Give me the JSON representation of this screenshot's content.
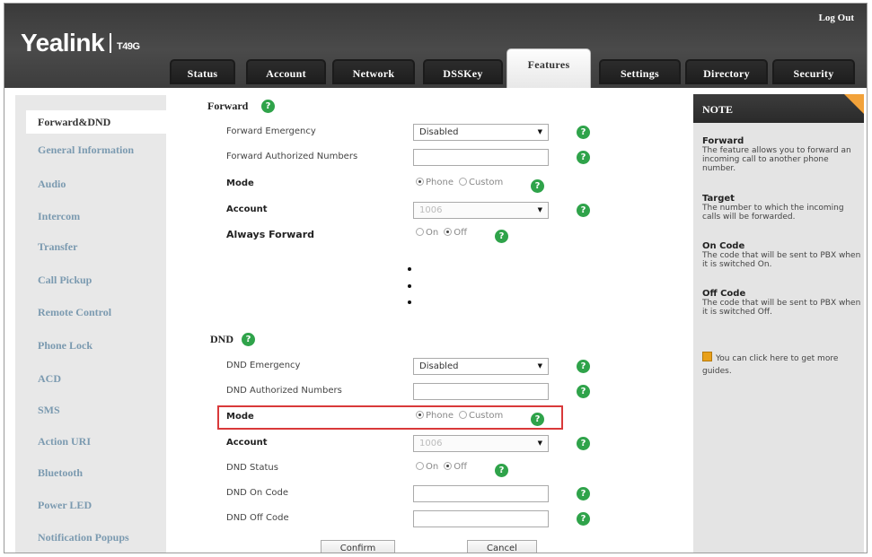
{
  "header": {
    "brand": "Yealink",
    "model": "T49G",
    "logout_label": "Log Out"
  },
  "tabs": [
    {
      "label": "Status"
    },
    {
      "label": "Account"
    },
    {
      "label": "Network"
    },
    {
      "label": "DSSKey"
    },
    {
      "label": "Features",
      "active": true
    },
    {
      "label": "Settings"
    },
    {
      "label": "Directory"
    },
    {
      "label": "Security"
    }
  ],
  "sidebar": {
    "items": [
      {
        "label": "Forward&DND",
        "active": true
      },
      {
        "label": "General Information"
      },
      {
        "label": "Audio"
      },
      {
        "label": "Intercom"
      },
      {
        "label": "Transfer"
      },
      {
        "label": "Call Pickup"
      },
      {
        "label": "Remote Control"
      },
      {
        "label": "Phone Lock"
      },
      {
        "label": "ACD"
      },
      {
        "label": "SMS"
      },
      {
        "label": "Action URI"
      },
      {
        "label": "Bluetooth"
      },
      {
        "label": "Power LED"
      },
      {
        "label": "Notification Popups"
      }
    ]
  },
  "forward": {
    "title": "Forward",
    "emergency_label": "Forward Emergency",
    "emergency_value": "Disabled",
    "authorized_label": "Forward Authorized Numbers",
    "authorized_value": "",
    "mode_label": "Mode",
    "mode_options": [
      "Phone",
      "Custom"
    ],
    "mode_selected": "Phone",
    "account_label": "Account",
    "account_value": "1006",
    "always_label": "Always Forward",
    "always_options": [
      "On",
      "Off"
    ],
    "always_selected": "Off"
  },
  "dnd": {
    "title": "DND",
    "emergency_label": "DND Emergency",
    "emergency_value": "Disabled",
    "authorized_label": "DND Authorized Numbers",
    "authorized_value": "",
    "mode_label": "Mode",
    "mode_options": [
      "Phone",
      "Custom"
    ],
    "mode_selected": "Phone",
    "account_label": "Account",
    "account_value": "1006",
    "status_label": "DND Status",
    "status_options": [
      "On",
      "Off"
    ],
    "status_selected": "Off",
    "on_code_label": "DND On Code",
    "on_code_value": "",
    "off_code_label": "DND Off Code",
    "off_code_value": ""
  },
  "buttons": {
    "confirm": "Confirm",
    "cancel": "Cancel"
  },
  "help_glyph": "?",
  "select_arrow": "▼",
  "note": {
    "title": "NOTE",
    "entries": [
      {
        "title": "Forward",
        "text": "The feature allows you to forward an incoming call to another phone number."
      },
      {
        "title": "Target",
        "text": "The number to which the incoming calls will be forwarded."
      },
      {
        "title": "On Code",
        "text": "The code that will be sent to PBX when it is switched On."
      },
      {
        "title": "Off Code",
        "text": "The code that will be sent to PBX when it is switched Off."
      }
    ],
    "guide_text": "You can click here to get more guides."
  },
  "colors": {
    "accent_orange": "#f2a23a",
    "help_green": "#2fa34a",
    "highlight_red": "#d9393a",
    "sidebar_link": "#7b9ab0"
  }
}
